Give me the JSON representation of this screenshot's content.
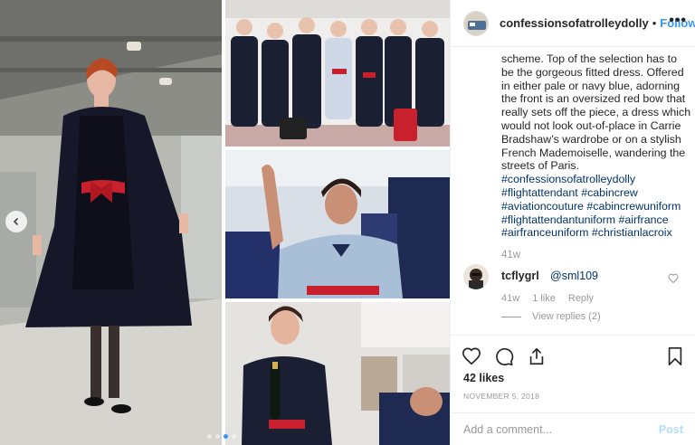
{
  "post": {
    "username": "confessionsofatrolleydolly",
    "separator": "•",
    "follow_label": "Follow",
    "more_label": "•••",
    "caption_lines": [
      "scheme. Top of the selection has to",
      "be the gorgeous fitted dress. Offered",
      "in either pale or navy blue, adorning",
      "the front is an oversized red bow that",
      "really sets off the piece, a dress which",
      "would not look out-of-place in Carrie",
      "Bradshaw’s wardrobe or on a stylish",
      "French Mademoiselle, wandering the",
      "streets of Paris."
    ],
    "hashtags": {
      "line1": [
        "#confessionsofatrolleydolly"
      ],
      "line2": [
        "#flightattendant",
        "#cabincrew"
      ],
      "line3": [
        "#aviationcouture",
        "#cabincrewuniform"
      ],
      "line4": [
        "#flightattendantuniform",
        "#airfrance"
      ],
      "line5": [
        "#airfranceuniform",
        "#christianlacroix"
      ]
    },
    "caption_time": "41w",
    "comment": {
      "username": "tcflygrl",
      "mention": "@sml109",
      "time": "41w",
      "likes": "1 like",
      "reply_label": "Reply",
      "view_replies": "View replies (2)"
    },
    "likes": "42 likes",
    "date": "NOVEMBER 5, 2018",
    "comment_placeholder": "Add a comment...",
    "post_label": "Post"
  },
  "media": {
    "slide_count": 4,
    "active_slide": 3
  },
  "colors": {
    "link": "#003569",
    "follow": "#3897f0",
    "muted": "#999999",
    "post_disabled": "#b2dffc",
    "uniform_red": "#c8202c",
    "navy": "#1c2033"
  }
}
